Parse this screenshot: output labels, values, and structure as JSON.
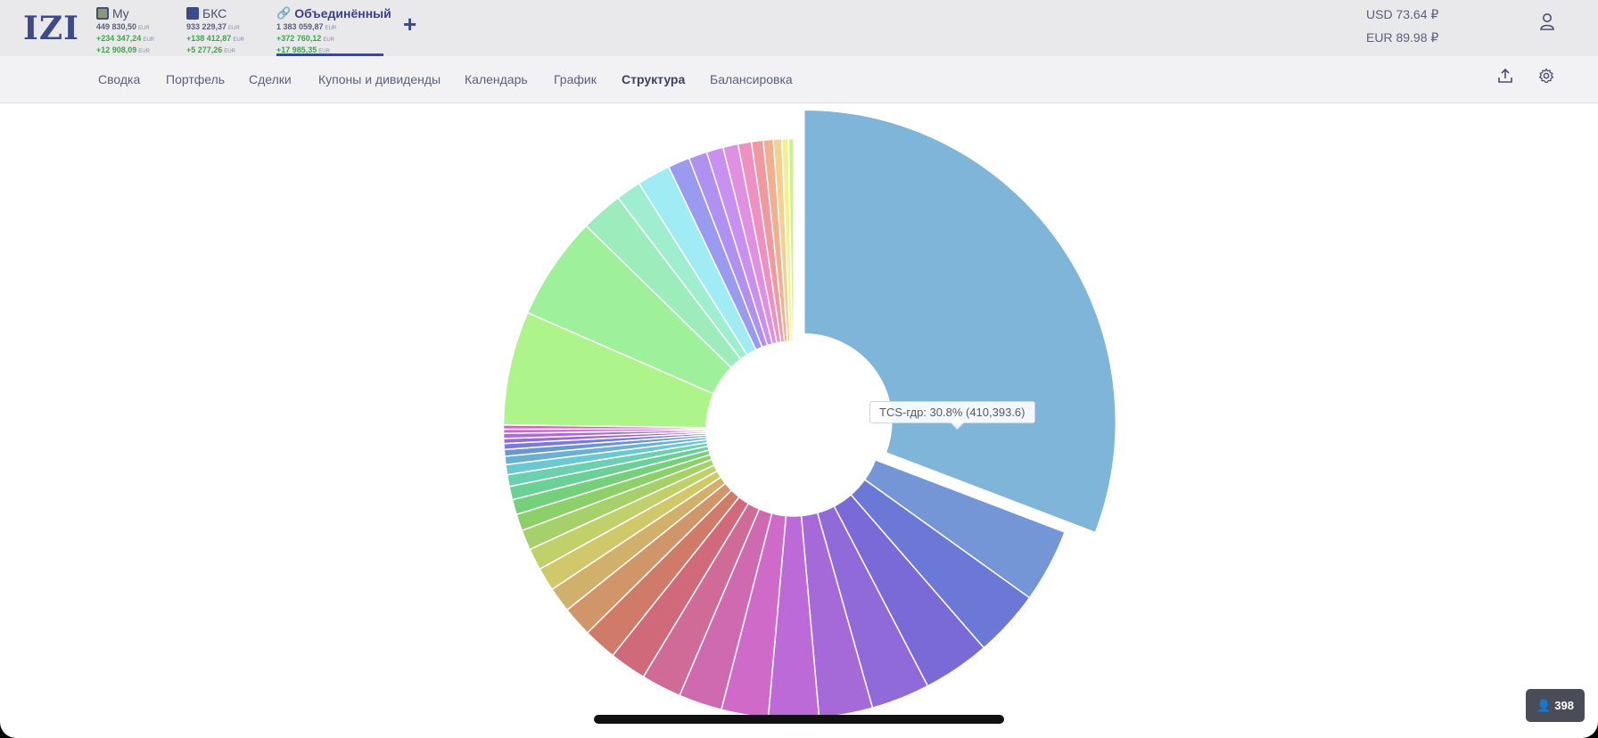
{
  "app": {
    "logo": "IZI"
  },
  "accounts": [
    {
      "name": "My",
      "total": "449 830,50",
      "total_cur": "EUR",
      "change1": "+234 347,24",
      "change1_cur": "EUR",
      "change2": "+12 908,09",
      "change2_cur": "EUR",
      "icon_color": "#8a9a78",
      "icon": "portfolio-icon"
    },
    {
      "name": "БКС",
      "total": "933 229,37",
      "total_cur": "EUR",
      "change1": "+138 412,87",
      "change1_cur": "EUR",
      "change2": "+5 277,26",
      "change2_cur": "EUR",
      "icon_color": "#3c4a8c",
      "icon": "bks-logo-icon"
    },
    {
      "name": "Объединённый",
      "total": "1 383 059,87",
      "total_cur": "EUR",
      "change1": "+372 760,12",
      "change1_cur": "EUR",
      "change2": "+17 985,35",
      "change2_cur": "EUR",
      "icon_color": "#d04050",
      "icon": "link-icon",
      "active": true
    }
  ],
  "add_account_label": "+",
  "rates": {
    "usd": "USD 73.64 ₽",
    "eur": "EUR 89.98 ₽"
  },
  "nav": {
    "items": [
      "Сводка",
      "Портфель",
      "Сделки",
      "Купоны и дивиденды",
      "Календарь",
      "График",
      "Структура",
      "Балансировка"
    ],
    "active": "Структура"
  },
  "tooltip": "TCS-гдр: 30.8% (410,393.6)",
  "badge": {
    "count": "398",
    "icon": "person-icon"
  },
  "chart_data": {
    "type": "pie",
    "variant": "donut",
    "highlighted": {
      "label": "TCS-гдр",
      "percent": 30.8,
      "value": 410393.6,
      "color": "#7eb5d8"
    },
    "slices_other_percent": [
      4.4,
      4.0,
      4.0,
      3.5,
      3.2,
      3.0,
      2.8,
      2.6,
      2.4,
      2.2,
      2.0,
      1.8,
      1.5,
      1.4,
      1.3,
      1.2,
      1.0,
      0.9,
      0.8,
      0.7,
      0.6,
      0.5,
      0.4,
      0.35,
      0.3,
      0.3,
      0.25,
      0.25,
      6.8,
      6.2,
      2.5,
      1.5,
      2.0,
      1.3,
      1.1,
      1.0,
      0.9,
      0.8,
      0.7,
      0.6,
      0.5,
      0.4,
      0.3
    ],
    "slice_colors": [
      "#7596d6",
      "#6b78d6",
      "#7a6ad8",
      "#8f6ad8",
      "#a56ad8",
      "#bc6ad8",
      "#cf6ac8",
      "#d06ab0",
      "#d06a96",
      "#d06a7a",
      "#d07a6a",
      "#d0966a",
      "#d0b06a",
      "#d0c86a",
      "#c0d06a",
      "#a6d06a",
      "#8cd06a",
      "#74d07a",
      "#6ad096",
      "#6ad0b0",
      "#6ac8d0",
      "#6ab0d0",
      "#6a96d0",
      "#7a7ad8",
      "#966ad8",
      "#b06ad8",
      "#c86ad0",
      "#d06ac0",
      "#adf48a",
      "#9ef09a",
      "#9cecbc",
      "#a0eed0",
      "#a0ecf4",
      "#9a9af0",
      "#b090f0",
      "#c890f0",
      "#e090e0",
      "#f090c0",
      "#f09aa0",
      "#f0b090",
      "#f4d090",
      "#f4f090",
      "#c8f490"
    ]
  }
}
